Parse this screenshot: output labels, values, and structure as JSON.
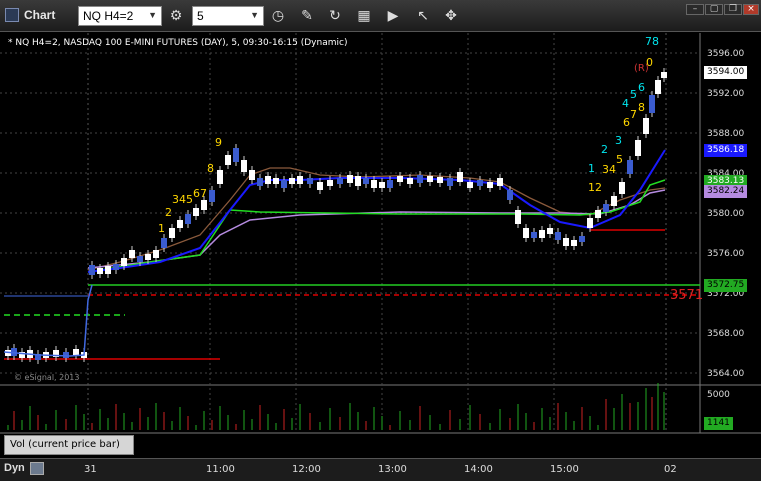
{
  "app": {
    "title": "Chart"
  },
  "toolbar": {
    "symbol": "NQ H4=2",
    "interval": "5"
  },
  "chart": {
    "subtitle": "* NQ H4=2, NASDAQ 100 E-MINI FUTURES (DAY), 5, 09:30-16:15 (Dynamic)",
    "price_axis": [
      "3596.00",
      "3592.00",
      "3588.00",
      "3584.00",
      "3580.00",
      "3576.00",
      "3572.00",
      "3568.00",
      "3564.00"
    ],
    "time_axis": [
      "31",
      "11:00",
      "12:00",
      "13:00",
      "14:00",
      "15:00",
      "02"
    ],
    "labels": {
      "last": "3594.00",
      "ma_blue": "3586.18",
      "ma_green": "3583.13",
      "ma_purple": "3582.24",
      "level_green": "3572.75",
      "level_red": "3571"
    },
    "annotations": {
      "a1": "1",
      "a2": "2",
      "a3": "345",
      "a4": "67",
      "a5": "8",
      "a6": "9",
      "b1": "1",
      "b2": "2",
      "b3": "3",
      "b4": "4",
      "b5": "5",
      "b6": "6",
      "b7": "7",
      "b8": "8",
      "b9": "78",
      "b10": "(R)",
      "b11": "0",
      "c1": "12",
      "c2": "34",
      "c3": "5",
      "c4": "6",
      "c5": "7",
      "c6": "8"
    },
    "watermark": "© eSignal, 2013"
  },
  "volume": {
    "label": "Vol (current price bar)",
    "axis": "5000",
    "value": "1141"
  },
  "bottom": {
    "mode": "Dyn"
  },
  "colors": {
    "up": "#ffffff",
    "down": "#3b5ccf",
    "blue_ma": "#1a1aff",
    "green_ma": "#22dd22",
    "purple_ma": "#b58be0",
    "brown_ma": "#8b5a3c",
    "red_level": "#dd0000"
  }
}
